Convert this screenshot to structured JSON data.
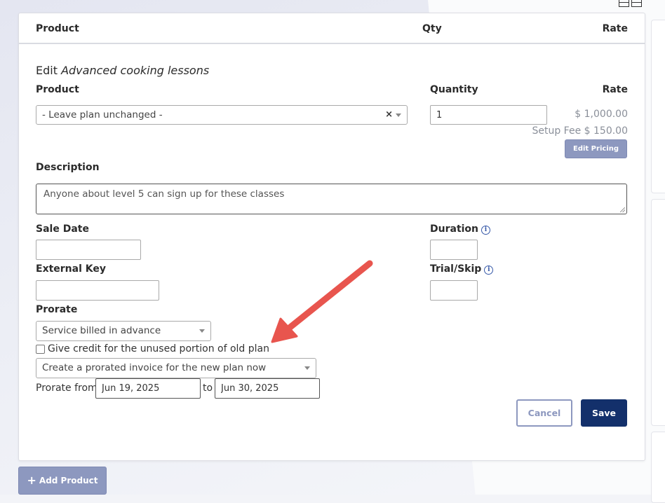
{
  "table_header": {
    "product": "Product",
    "qty": "Qty",
    "rate": "Rate"
  },
  "edit": {
    "prefix": "Edit",
    "item_name": "Advanced cooking lessons",
    "product_label": "Product",
    "product_value": "- Leave plan unchanged -",
    "product_clear": "×",
    "quantity_label": "Quantity",
    "quantity_value": "1",
    "rate_label": "Rate",
    "rate_value": "$ 1,000.00",
    "setup_fee": "Setup Fee $ 150.00",
    "edit_pricing": "Edit Pricing",
    "description_label": "Description",
    "description_value": "Anyone about level 5 can sign up for these classes",
    "sale_date_label": "Sale Date",
    "sale_date_value": "",
    "duration_label": "Duration",
    "duration_value": "",
    "external_key_label": "External Key",
    "external_key_value": "",
    "trial_skip_label": "Trial/Skip",
    "trial_skip_value": "",
    "prorate_label": "Prorate",
    "prorate_value": "Service billed in advance",
    "credit_checkbox_label": "Give credit for the unused portion of old plan",
    "credit_checked": false,
    "invoice_option": "Create a prorated invoice for the new plan now",
    "prorate_from_label": "Prorate from",
    "prorate_from_value": "Jun 19, 2025",
    "to_label": "to",
    "prorate_to_value": "Jun 30, 2025",
    "cancel": "Cancel",
    "save": "Save"
  },
  "add_product": {
    "icon": "plus-icon",
    "label": "Add Product"
  },
  "colors": {
    "primary": "#13306b",
    "muted_button": "#8d98bf",
    "annotation_arrow": "#e8554e",
    "info_icon": "#3658a8"
  }
}
